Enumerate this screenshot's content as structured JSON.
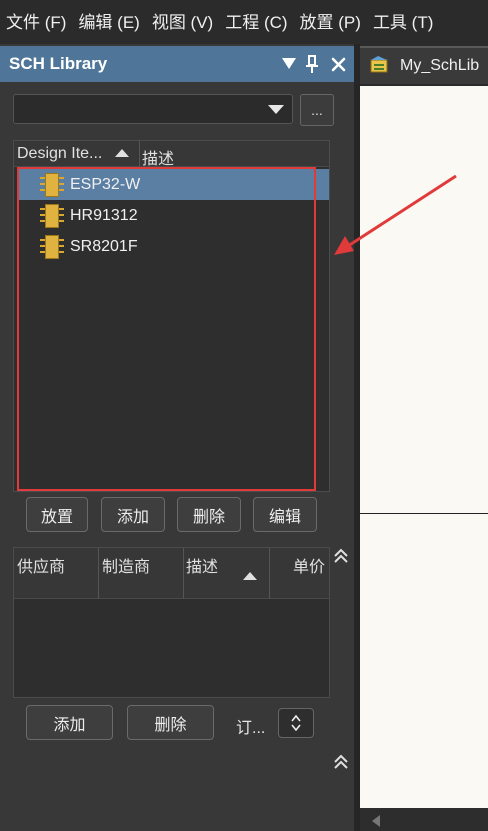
{
  "menubar": {
    "items": [
      "文件 (F)",
      "编辑 (E)",
      "视图 (V)",
      "工程 (C)",
      "放置 (P)",
      "工具 (T)"
    ]
  },
  "panel": {
    "title": "SCH Library",
    "header_icons": [
      "menu-dropdown-icon",
      "pin-icon",
      "close-icon"
    ],
    "search": {
      "value": "",
      "browse_label": "..."
    },
    "list": {
      "columns": [
        "Design Ite...",
        "描述"
      ],
      "items": [
        {
          "name": "ESP32-W",
          "selected": true
        },
        {
          "name": "HR91312",
          "selected": false
        },
        {
          "name": "SR8201F",
          "selected": false
        }
      ]
    },
    "buttons": {
      "place": "放置",
      "add": "添加",
      "delete": "删除",
      "edit": "编辑"
    },
    "supplier_grid": {
      "columns": [
        "供应商",
        "制造商",
        "描述",
        "单价"
      ]
    },
    "supplier_buttons": {
      "add": "添加",
      "delete": "删除"
    },
    "order_label": "订..."
  },
  "document": {
    "tab_label": "My_SchLib"
  },
  "annotation": {
    "highlight_color": "#e03a3a"
  },
  "colors": {
    "selection": "#5b7fa3",
    "header": "#4f7699"
  }
}
